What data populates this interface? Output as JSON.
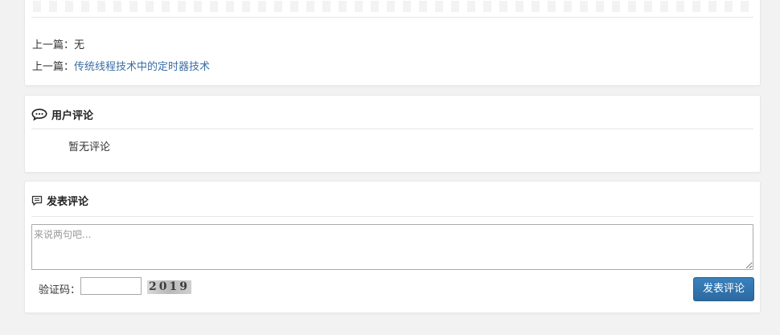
{
  "article_nav": {
    "prev_label": "上一篇：",
    "prev_value": "无",
    "next_label": "上一篇：",
    "next_link": "传统线程技术中的定时器技术"
  },
  "comments": {
    "title": "用户评论",
    "icon": "chat-bubble-icon",
    "empty_text": "暂无评论"
  },
  "post_comment": {
    "title": "发表评论",
    "icon": "comment-icon",
    "textarea_placeholder": "来说两句吧...",
    "captcha_label": "验证码：",
    "captcha_value": "",
    "captcha_code": "2019",
    "submit_label": "发表评论"
  },
  "colors": {
    "background": "#f2f2f2",
    "panel": "#ffffff",
    "link": "#3a6ea5",
    "button": "#2f73ad"
  }
}
